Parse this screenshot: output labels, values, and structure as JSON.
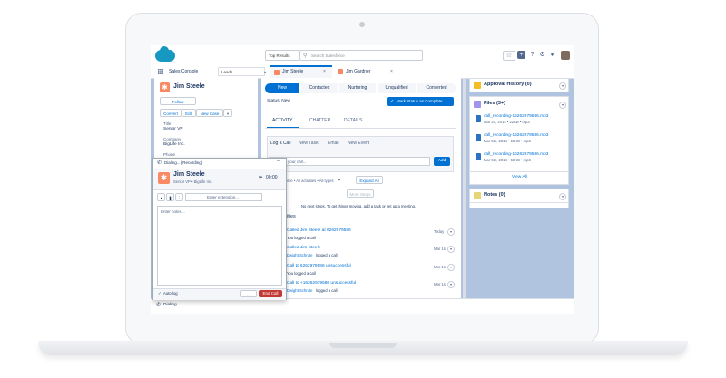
{
  "header": {
    "search_scope": "Top Results",
    "search_placeholder": "Search Salesforce",
    "icons": [
      "star-icon",
      "add-icon",
      "help-icon",
      "setup-icon",
      "notifications-icon"
    ]
  },
  "tabbar": {
    "app_name": "Sales Console",
    "nav_select": "Leads",
    "tabs": [
      {
        "label": "Jim Steele",
        "icon": "lead-icon",
        "active": true
      },
      {
        "label": "Jim Gardner",
        "icon": "lead-icon",
        "active": false
      }
    ]
  },
  "lead": {
    "name": "Jim Steele",
    "follow_label": "Follow",
    "actions": [
      "Convert",
      "Edit",
      "New Case"
    ],
    "fields": [
      {
        "label": "Title",
        "value": "Senior VP"
      },
      {
        "label": "Company",
        "value": "BigLife Inc."
      },
      {
        "label": "Phone",
        "value": ""
      }
    ]
  },
  "path": {
    "steps": [
      "New",
      "Contacted",
      "Nurturing",
      "Unqualified",
      "Converted"
    ],
    "active_step": 0,
    "status_text": "Status: New",
    "mark_button": "Mark Status as Complete"
  },
  "record_tabs": [
    "ACTIVITY",
    "CHATTER",
    "DETAILS"
  ],
  "activity": {
    "composer_tabs": [
      "Log a Call",
      "New Task",
      "Email",
      "New Event"
    ],
    "input_placeholder": "your call...",
    "add_button": "Add",
    "filter_text": "ime • All activities • All types",
    "expand_label": "Expand All",
    "more_steps": "More Steps",
    "no_next_steps": "No next steps. To get things moving, add a task or set up a meeting.",
    "section_label": "ities",
    "items": [
      {
        "title": "Called Jim Steele at 6262979586",
        "sub_name": "",
        "sub_text": "You logged a call",
        "date": "Today"
      },
      {
        "title": "Called Jim Steele",
        "sub_name": "Dwight Schrute",
        "sub_text": "logged a call",
        "date": "Mar 1s"
      },
      {
        "title": "Call to 6262979586 unsuccessful",
        "sub_name": "",
        "sub_text": "You logged a call",
        "date": "Mar 1s"
      },
      {
        "title": "Call to +16262979586 unsuccessful",
        "sub_name": "Dwight Schrute",
        "sub_text": "logged a call",
        "date": "Mar 1s"
      }
    ]
  },
  "approval": {
    "title": "Approval History (0)"
  },
  "files": {
    "title": "Files (3+)",
    "items": [
      {
        "name": "call_recording-16262979586.mp3",
        "meta": "Mar 20, 2014 • 22KB • mp3"
      },
      {
        "name": "call_recording-16262979586.mp3",
        "meta": "Mar 5th, 2014 • 58KB • mp3"
      },
      {
        "name": "call_recording-16262979586.mp3",
        "meta": "Mar 5th, 2014 • 58KB • mp3"
      }
    ],
    "view_all": "View All"
  },
  "notes": {
    "title": "Notes (0)"
  },
  "softphone": {
    "status": "Dialing... (Recording)",
    "name": "Jim Steele",
    "subtitle": "Senior VP  •  BigLife Inc.",
    "timer": "00:00",
    "extension_placeholder": "Enter extension...",
    "notes_placeholder": "Enter notes...",
    "autolog_label": "Auto-log",
    "end_call": "End Call"
  },
  "footer": {
    "status": "Dialing..."
  },
  "colors": {
    "brand": "#1798c1",
    "primary": "#0070d2",
    "lead": "#f88962",
    "end_call": "#c23934",
    "path_active": "#0070d2",
    "background": "#b0c4df"
  }
}
